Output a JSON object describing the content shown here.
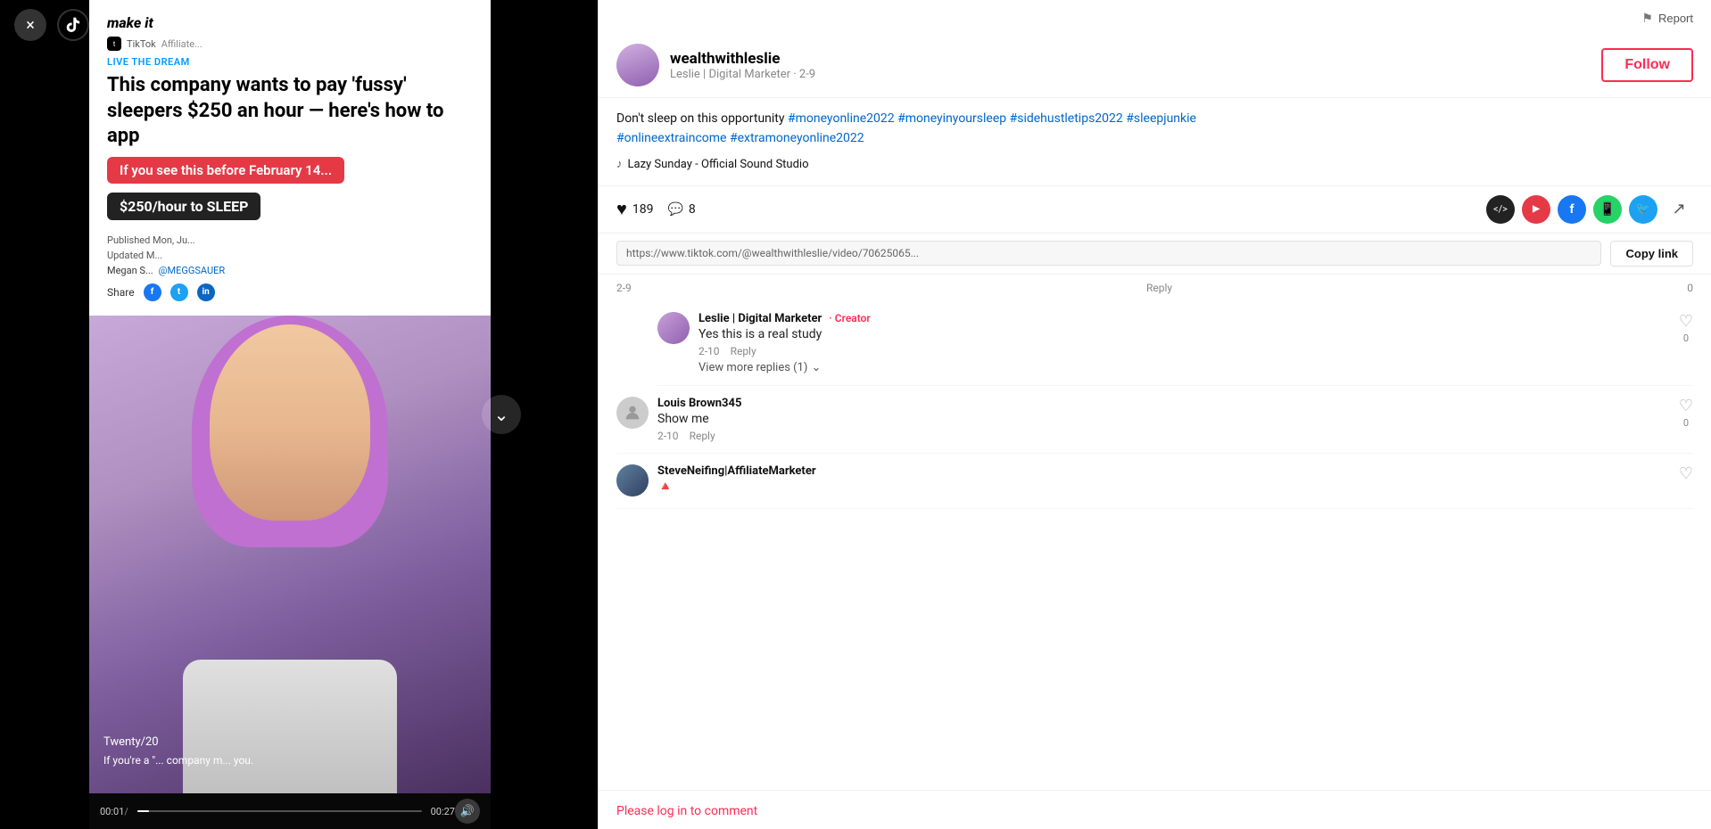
{
  "app": {
    "title": "TikTok",
    "close_label": "×"
  },
  "header": {
    "report_label": "Report",
    "flag_icon": "⚑"
  },
  "user": {
    "username": "wealthwithleslie",
    "subtitle": "Leslie | Digital Marketer · 2-9",
    "follow_label": "Follow"
  },
  "description": {
    "text": "Don't sleep on this opportunity ",
    "hashtags": [
      "#moneyonline2022",
      "#moneyinyoursleep",
      "#sidehustletips2022",
      "#sleepjunkie",
      "#onlineextraincome",
      "#extramoneyonline2022"
    ],
    "sound": "Lazy Sunday - Official Sound Studio"
  },
  "actions": {
    "likes_count": "189",
    "comments_count": "8",
    "heart_icon": "♥",
    "comment_icon": "💬",
    "share_label": "Share"
  },
  "link": {
    "url": "https://www.tiktok.com/@wealthwithleslie/video/70625065...",
    "copy_label": "Copy link"
  },
  "article": {
    "source": "make it",
    "category": "LIVE THE DREAM",
    "title": "This company wants to pay 'fussy' sleepers $250 an hour — here's how to app",
    "bubble1": "If you see this before February 14...",
    "bubble2": "$250/hour to SLEEP",
    "published": "Published Mon, Ju...",
    "updated": "Updated M...",
    "author": "@MEGGSAUER",
    "share_label": "Share"
  },
  "video": {
    "time_current": "00:01",
    "time_total": "00:27",
    "progress_percent": 4,
    "slide_label": "Twenty/20",
    "caption": "If you're a \"... company m... you."
  },
  "comments": [
    {
      "id": "comment-leslie",
      "author": "Leslie | Digital Marketer",
      "is_creator": true,
      "creator_label": "Creator",
      "text": "Yes this is a real study",
      "date": "2-10",
      "reply_label": "Reply",
      "likes": "0",
      "nested_replies": [
        {
          "id": "reply-1",
          "label": "View more replies (1)"
        }
      ]
    },
    {
      "id": "comment-louis",
      "author": "Louis Brown345",
      "is_creator": false,
      "text": "Show me",
      "date": "2-10",
      "reply_label": "Reply",
      "likes": "0"
    },
    {
      "id": "comment-steve",
      "author": "SteveNeifing|AffiliateMarketer",
      "is_creator": false,
      "text": "🔺",
      "date": "",
      "reply_label": "",
      "likes": ""
    }
  ],
  "login_bar": {
    "text": "Please log in to comment"
  },
  "prev_comment": {
    "date": "2-9",
    "reply_label": "Reply"
  }
}
